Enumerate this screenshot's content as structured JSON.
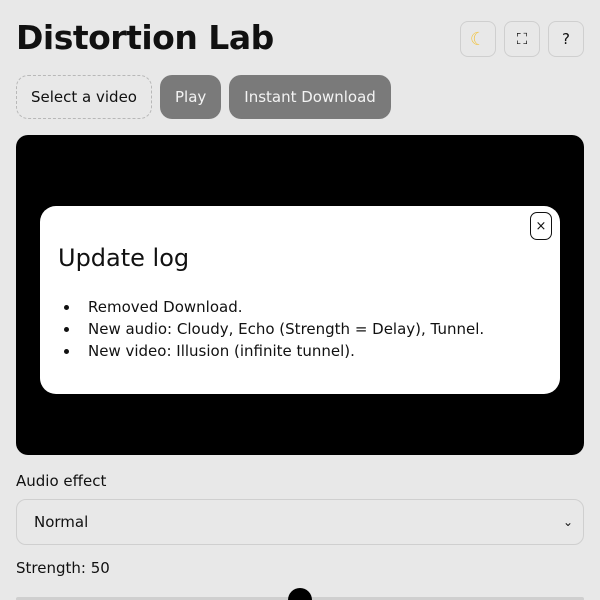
{
  "app": {
    "title": "Distortion Lab"
  },
  "top_icons": {
    "theme": "☾",
    "fullscreen": "⛶",
    "help": "?"
  },
  "actions": {
    "select_video": "Select a video",
    "play": "Play",
    "instant_download": "Instant Download"
  },
  "update_log": {
    "title": "Update log",
    "close": "×",
    "items": [
      "Removed Download.",
      "New audio: Cloudy, Echo (Strength = Delay), Tunnel.",
      "New video: Illusion (infinite tunnel)."
    ]
  },
  "audio_effect": {
    "label": "Audio effect",
    "selected": "Normal",
    "chevron": "⌄"
  },
  "strength": {
    "label": "Strength: 50",
    "value": 50
  },
  "colors": {
    "background": "#e8e8e8",
    "button_gray": "#7a7a7a",
    "player_bg": "#000000",
    "modal_bg": "#ffffff",
    "moon": "#f1c64a"
  },
  "icons": {
    "theme": "moon-icon",
    "fullscreen": "fullscreen-icon",
    "help": "help-icon",
    "close": "close-icon",
    "select": "chevron-down-icon"
  }
}
